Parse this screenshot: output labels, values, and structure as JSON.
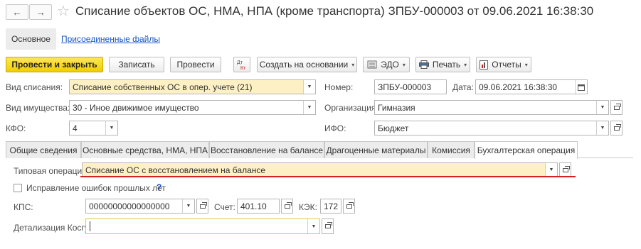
{
  "window": {
    "title": "Списание объектов ОС, НМА, НПА (кроме транспорта) ЗПБУ-000003 от 09.06.2021 16:38:30",
    "nav_back_icon": "←",
    "nav_forward_icon": "→",
    "favorite_icon": "☆"
  },
  "section_tabs": {
    "main": "Основное",
    "attachments": "Присоединенные файлы"
  },
  "toolbar": {
    "post_and_close": "Провести и закрыть",
    "save": "Записать",
    "post": "Провести",
    "create_based_on": "Создать на основании",
    "edo": "ЭДО",
    "print": "Печать",
    "reports": "Отчеты",
    "dropdown_caret": "▾"
  },
  "header": {
    "writeoff_type_label": "Вид списания:",
    "writeoff_type_value": "Списание собственных ОС в опер. учете (21)",
    "number_label": "Номер:",
    "number_value": "ЗПБУ-000003",
    "date_label": "Дата:",
    "date_value": "09.06.2021 16:38:30",
    "property_type_label": "Вид имущества:",
    "property_type_value": "30 - Иное движимое имущество",
    "organization_label": "Организация:",
    "organization_value": "Гимназия",
    "kfo_label": "КФО:",
    "kfo_value": "4",
    "ifo_label": "ИФО:",
    "ifo_value": "Бюджет"
  },
  "tabs": [
    {
      "label": "Общие сведения",
      "active": false
    },
    {
      "label": "Основные средства, НМА, НПА",
      "active": false
    },
    {
      "label": "Восстановление на балансе",
      "active": false
    },
    {
      "label": "Драгоценные материалы",
      "active": false
    },
    {
      "label": "Комиссия",
      "active": false
    },
    {
      "label": "Бухгалтерская операция",
      "active": true
    }
  ],
  "accounting": {
    "typical_operation_label": "Типовая операция:",
    "typical_operation_value": "Списание ОС с восстановлением на балансе",
    "error_fix_label": "Исправление ошибок прошлых лет",
    "error_fix_checked": false,
    "help_mark": "?",
    "kps_label": "КПС:",
    "kps_value": "00000000000000000",
    "account_label": "Счет:",
    "account_value": "401.10",
    "kek_label": "КЭК:",
    "kek_value": "172",
    "kosgu_detail_label": "Детализация Косгу:",
    "kosgu_detail_value": ""
  },
  "colors": {
    "primary_button": "#f2cd00",
    "highlight_field": "#fdf0c4",
    "link": "#1a56c6",
    "underline_mark": "#d62020"
  }
}
